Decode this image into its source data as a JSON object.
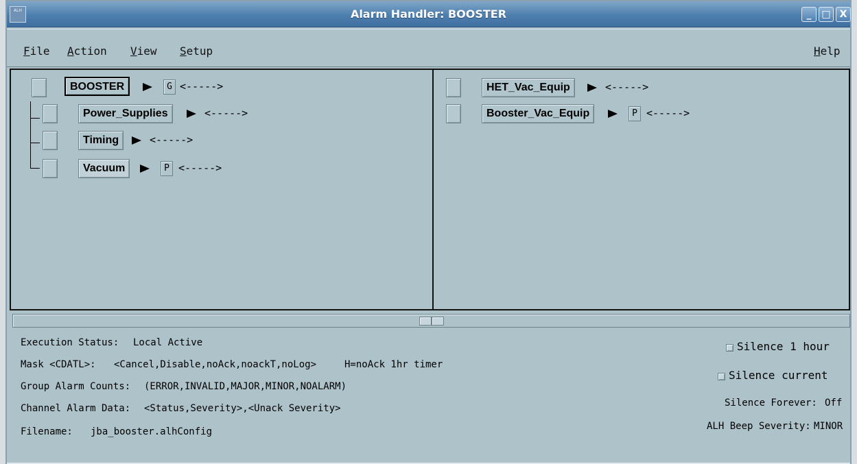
{
  "window": {
    "title": "Alarm Handler: BOOSTER",
    "icon_text": "ALH",
    "buttons": {
      "minimize": "_",
      "maximize": "□",
      "close": "X"
    }
  },
  "menu": {
    "file": "File",
    "action": "Action",
    "view": "View",
    "setup": "Setup",
    "help": "Help"
  },
  "tree": {
    "root": {
      "label": "BOOSTER",
      "flag": "G",
      "counts": "<----->"
    },
    "children": [
      {
        "label": "Power_Supplies",
        "flag": "",
        "counts": "<----->"
      },
      {
        "label": "Timing",
        "flag": "",
        "counts": "<----->"
      },
      {
        "label": "Vacuum",
        "flag": "P",
        "counts": "<----->"
      }
    ]
  },
  "right_pane": {
    "items": [
      {
        "label": "HET_Vac_Equip",
        "flag": "",
        "counts": "<----->"
      },
      {
        "label": "Booster_Vac_Equip",
        "flag": "P",
        "counts": "<----->"
      }
    ]
  },
  "status": {
    "execution_label": "Execution Status:",
    "execution_value": "Local Active",
    "mask_label": "Mask <CDATL>:",
    "mask_value": "<Cancel,Disable,noAck,noackT,noLog>",
    "mask_note": "H=noAck 1hr timer",
    "group_counts_label": "Group Alarm Counts:",
    "group_counts_value": "(ERROR,INVALID,MAJOR,MINOR,NOALARM)",
    "channel_label": "Channel Alarm Data:",
    "channel_value": "<Status,Severity>,<Unack Severity>",
    "filename_label": "Filename:",
    "filename_value": "jba_booster.alhConfig",
    "silence_1_hour": "Silence 1 hour",
    "silence_current": "Silence current",
    "silence_forever_label": "Silence Forever:",
    "silence_forever_value": "Off",
    "beep_label": "ALH Beep Severity:",
    "beep_value": "MINOR"
  }
}
